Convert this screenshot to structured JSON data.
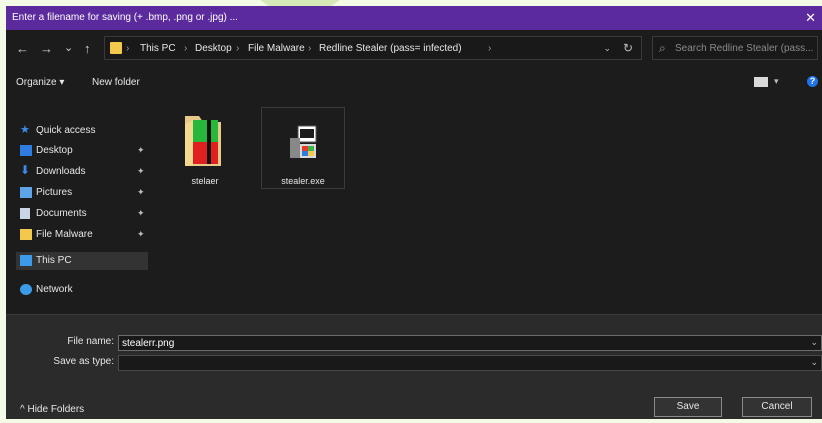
{
  "dialog": {
    "title": "Enter a filename for saving (+ .bmp, .png or .jpg) ...",
    "close_glyph": "✕"
  },
  "nav": {
    "back": "←",
    "forward": "→",
    "recent": "⌄",
    "up": "↑"
  },
  "address": {
    "crumbs": [
      "This PC",
      "File Malware",
      "Desktop",
      "Redline Stealer (pass= infected)"
    ],
    "separator": "›",
    "dropdown": "⌄",
    "refresh": "↻"
  },
  "search": {
    "icon": "⌕",
    "placeholder": "Search Redline Stealer (pass..."
  },
  "toolbar": {
    "organize_label": "Organize ▾",
    "new_folder_label": "New folder",
    "view_dropdown": "▾",
    "help_label": "?"
  },
  "sidebar": {
    "items": [
      {
        "label": "Quick access",
        "icon": "star-icon",
        "pinned": false
      },
      {
        "label": "Desktop",
        "icon": "desktop-icon",
        "pinned": true
      },
      {
        "label": "Downloads",
        "icon": "download-icon",
        "pinned": true
      },
      {
        "label": "Pictures",
        "icon": "pictures-icon",
        "pinned": true
      },
      {
        "label": "Documents",
        "icon": "documents-icon",
        "pinned": true
      },
      {
        "label": "File Malware",
        "icon": "folder-icon",
        "pinned": true
      },
      {
        "label": "This PC",
        "icon": "computer-icon",
        "pinned": false
      },
      {
        "label": "Network",
        "icon": "network-icon",
        "pinned": false
      }
    ],
    "pin_glyph": "✦"
  },
  "files": [
    {
      "name": "stelaer",
      "type": "folder"
    },
    {
      "name": "stealer.exe",
      "type": "executable"
    }
  ],
  "form": {
    "filename_label": "File name:",
    "filename_value": "stealerr.png",
    "savetype_label": "Save as type:",
    "savetype_value": "",
    "dropdown_glyph": "⌄"
  },
  "footer": {
    "hide_folders_label": "^  Hide Folders",
    "save_label": "Save",
    "cancel_label": "Cancel"
  },
  "colors": {
    "titlebar": "#5b2a9c",
    "dialog_bg": "#1c1c1c",
    "accent_blue": "#1e73e8",
    "folder_yellow": "#f2c94c"
  }
}
